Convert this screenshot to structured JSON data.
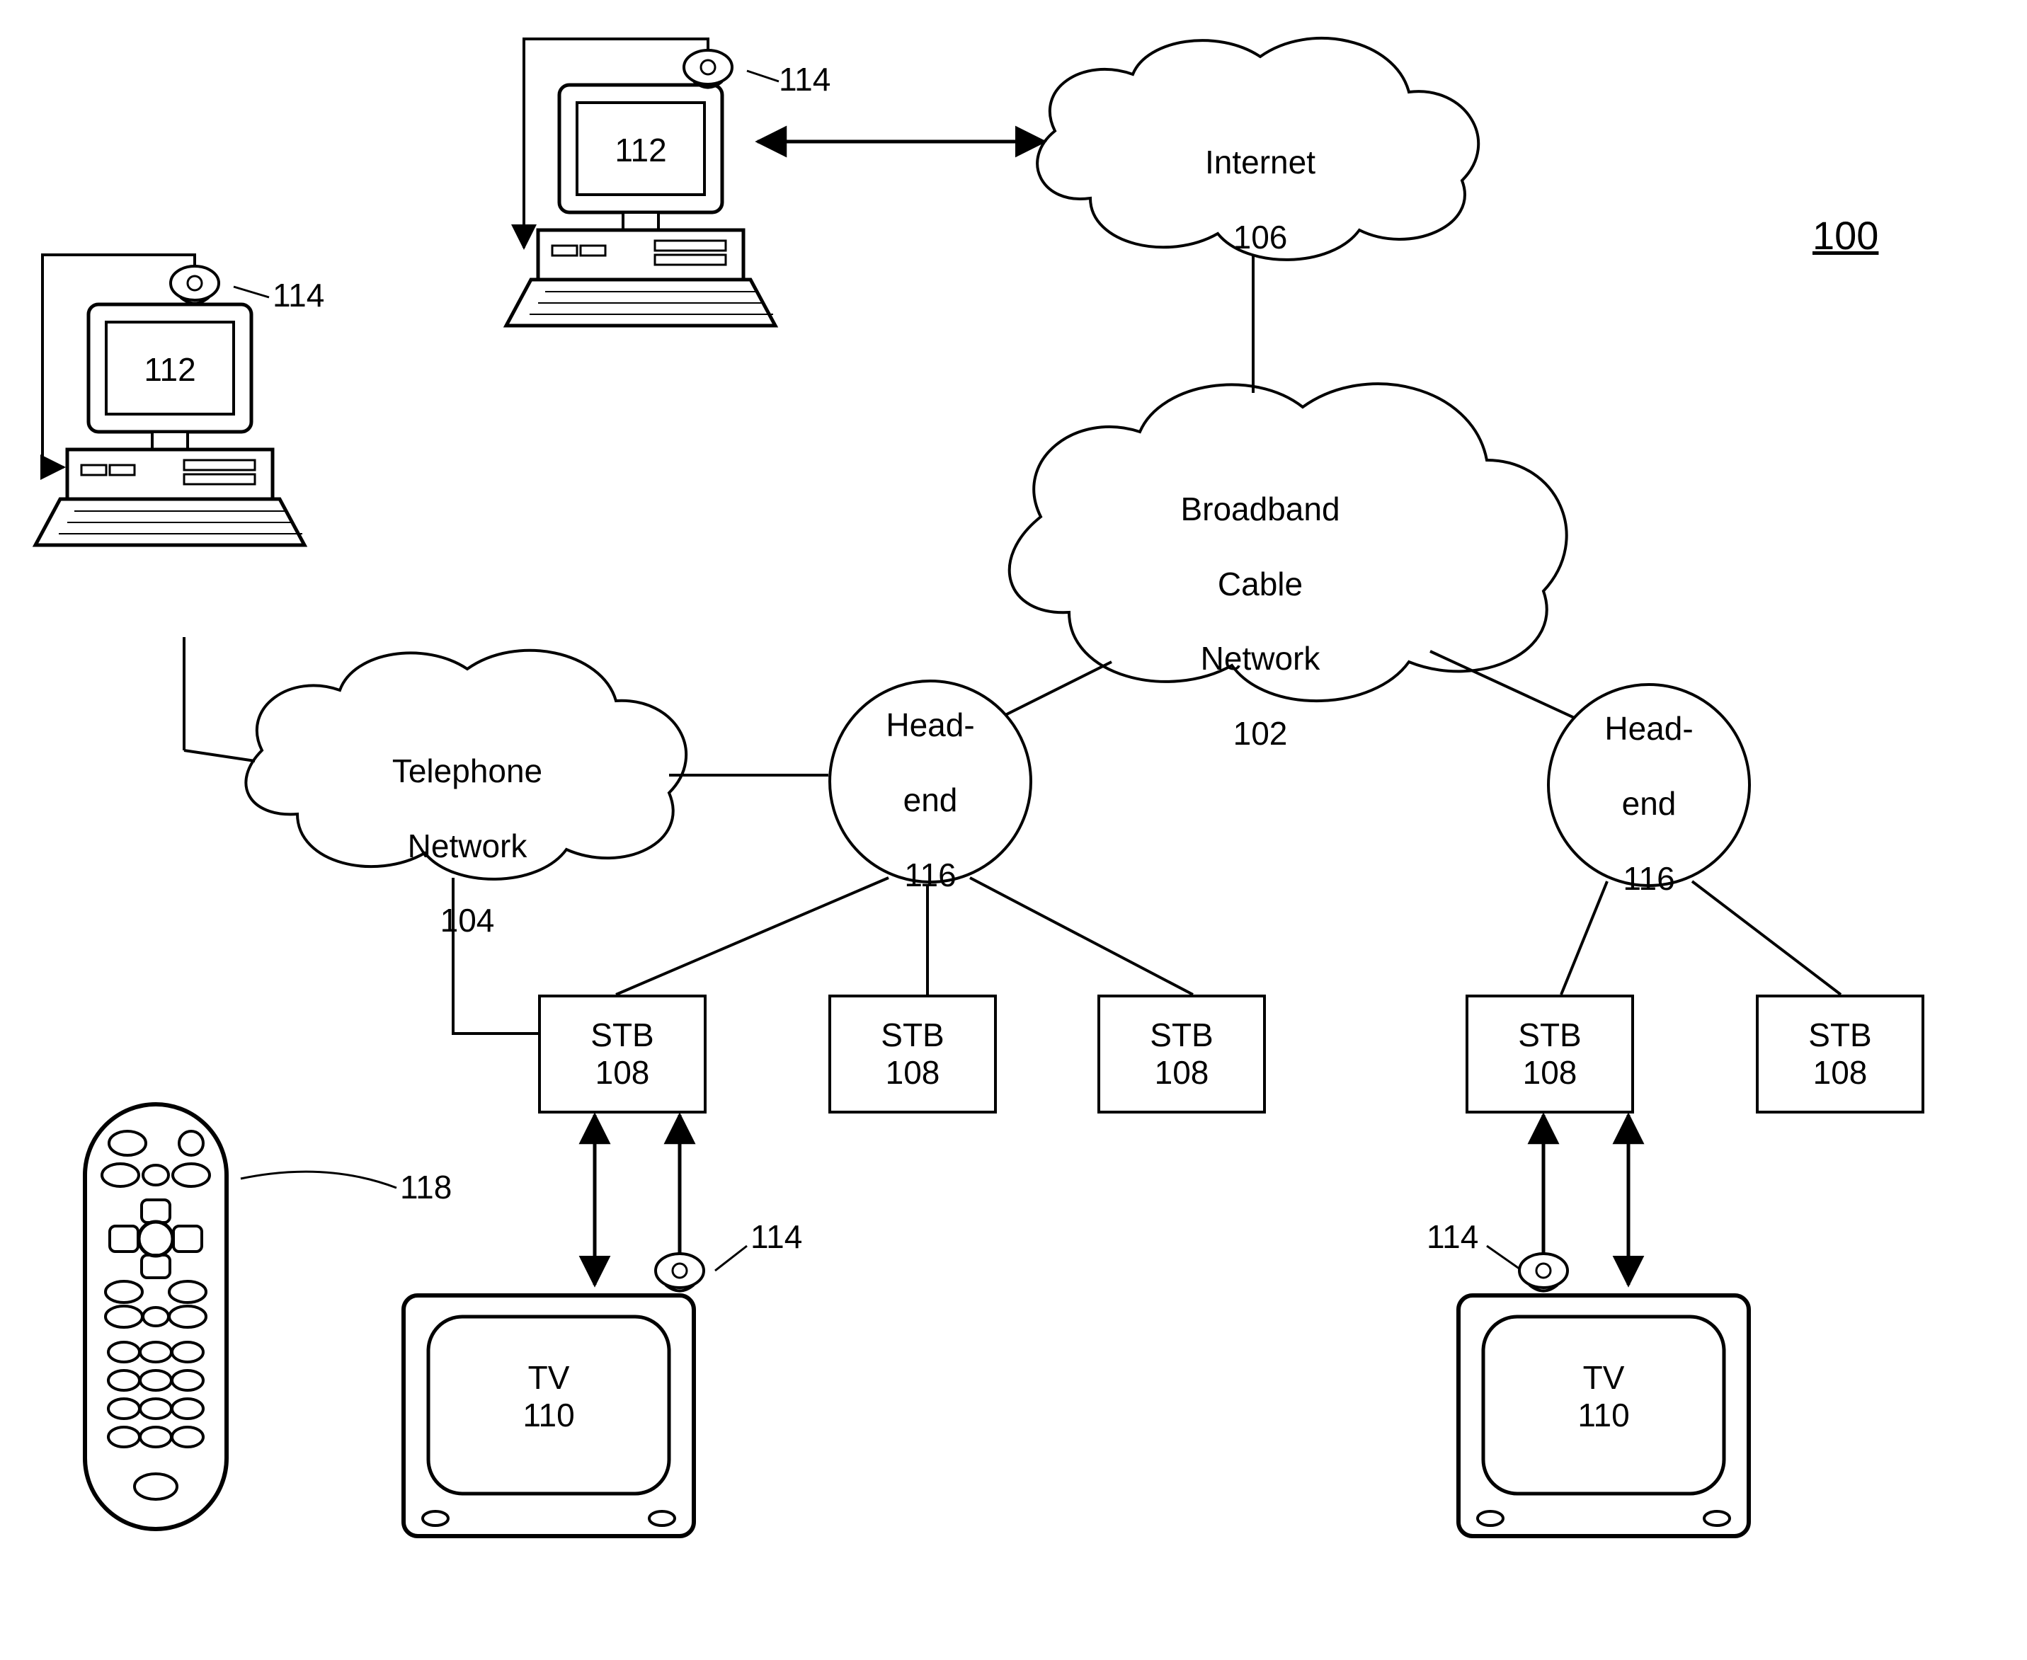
{
  "figure_id": "100",
  "clouds": {
    "internet": {
      "line1": "Internet",
      "line2": "106"
    },
    "broadband": {
      "line1": "Broadband",
      "line2": "Cable",
      "line3": "Network",
      "line4": "102"
    },
    "telephone": {
      "line1": "Telephone",
      "line2": "Network",
      "line3": "104"
    }
  },
  "headends": {
    "left": {
      "line1": "Head-",
      "line2": "end",
      "line3": "116"
    },
    "right": {
      "line1": "Head-",
      "line2": "end",
      "line3": "116"
    }
  },
  "stb_label": "STB\n108",
  "tv_label": "TV\n110",
  "computer_label": "112",
  "camera_label": "114",
  "remote_label": "118",
  "chart_data": {
    "type": "diagram",
    "title": "100",
    "nodes": [
      {
        "id": "internet",
        "kind": "cloud",
        "label": "Internet",
        "ref": "106"
      },
      {
        "id": "broadband",
        "kind": "cloud",
        "label": "Broadband Cable Network",
        "ref": "102"
      },
      {
        "id": "telephone",
        "kind": "cloud",
        "label": "Telephone Network",
        "ref": "104"
      },
      {
        "id": "headend_L",
        "kind": "circle",
        "label": "Head-end",
        "ref": "116"
      },
      {
        "id": "headend_R",
        "kind": "circle",
        "label": "Head-end",
        "ref": "116"
      },
      {
        "id": "stb_L1",
        "kind": "box",
        "label": "STB",
        "ref": "108"
      },
      {
        "id": "stb_L2",
        "kind": "box",
        "label": "STB",
        "ref": "108"
      },
      {
        "id": "stb_L3",
        "kind": "box",
        "label": "STB",
        "ref": "108"
      },
      {
        "id": "stb_R1",
        "kind": "box",
        "label": "STB",
        "ref": "108"
      },
      {
        "id": "stb_R2",
        "kind": "box",
        "label": "STB",
        "ref": "108"
      },
      {
        "id": "tv_L",
        "kind": "tv",
        "label": "TV",
        "ref": "110"
      },
      {
        "id": "tv_R",
        "kind": "tv",
        "label": "TV",
        "ref": "110"
      },
      {
        "id": "pc_top",
        "kind": "computer",
        "label": "",
        "ref": "112"
      },
      {
        "id": "pc_left",
        "kind": "computer",
        "label": "",
        "ref": "112"
      },
      {
        "id": "cam_pc_top",
        "kind": "camera",
        "ref": "114"
      },
      {
        "id": "cam_pc_left",
        "kind": "camera",
        "ref": "114"
      },
      {
        "id": "cam_tv_L",
        "kind": "camera",
        "ref": "114"
      },
      {
        "id": "cam_tv_R",
        "kind": "camera",
        "ref": "114"
      },
      {
        "id": "remote",
        "kind": "remote",
        "ref": "118"
      }
    ],
    "edges": [
      {
        "from": "pc_top",
        "to": "internet",
        "bidirectional": true
      },
      {
        "from": "internet",
        "to": "broadband"
      },
      {
        "from": "broadband",
        "to": "headend_L"
      },
      {
        "from": "broadband",
        "to": "headend_R"
      },
      {
        "from": "telephone",
        "to": "headend_L"
      },
      {
        "from": "telephone",
        "to": "stb_L1"
      },
      {
        "from": "pc_left",
        "to": "telephone"
      },
      {
        "from": "headend_L",
        "to": "stb_L1"
      },
      {
        "from": "headend_L",
        "to": "stb_L2"
      },
      {
        "from": "headend_L",
        "to": "stb_L3"
      },
      {
        "from": "headend_R",
        "to": "stb_R1"
      },
      {
        "from": "headend_R",
        "to": "stb_R2"
      },
      {
        "from": "stb_L1",
        "to": "tv_L",
        "bidirectional": true
      },
      {
        "from": "stb_R1",
        "to": "tv_R",
        "bidirectional": true
      },
      {
        "from": "cam_pc_top",
        "to": "pc_top"
      },
      {
        "from": "cam_pc_left",
        "to": "pc_left"
      },
      {
        "from": "cam_tv_L",
        "to": "stb_L1"
      },
      {
        "from": "cam_tv_R",
        "to": "stb_R1"
      }
    ]
  }
}
